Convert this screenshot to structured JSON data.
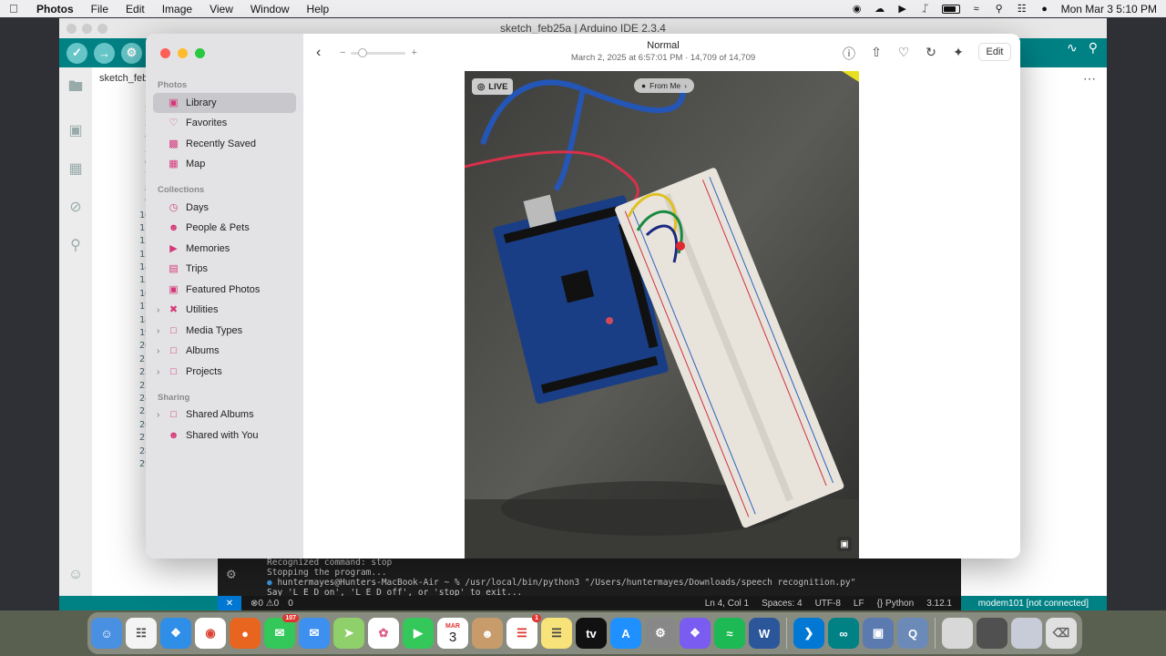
{
  "menubar": {
    "app": "Photos",
    "items": [
      "File",
      "Edit",
      "Image",
      "View",
      "Window",
      "Help"
    ],
    "clock": "Mon Mar 3  5:10 PM"
  },
  "arduino": {
    "title": "sketch_feb25a | Arduino IDE 2.3.4",
    "tab": "sketch_feb",
    "line_numbers": [
      "1",
      "2",
      "3",
      "4",
      "5",
      "6",
      "7",
      "8",
      "9",
      "10",
      "11",
      "12",
      "13",
      "14",
      "15",
      "16",
      "17",
      "18",
      "19",
      "20",
      "21",
      "22",
      "23",
      "24",
      "25",
      "26",
      "27",
      "28",
      "29"
    ],
    "code_fragments": [
      "c",
      "c",
      "c",
      "",
      "v",
      "",
      "",
      "",
      "",
      "}",
      "",
      "v",
      "",
      "",
      "",
      "",
      "",
      "",
      "",
      "",
      "",
      "",
      "",
      "",
      "",
      "",
      "",
      "",
      "}"
    ],
    "port_status": "modem101 [not connected]"
  },
  "terminal": {
    "lines": [
      "Recognized command: stop",
      "Stopping the program...",
      "huntermayes@Hunters-MacBook-Air ~ % /usr/local/bin/python3 \"/Users/huntermayes/Downloads/speech recognition.py\"",
      "Say 'L E D on', 'L E D off', or 'stop' to exit..."
    ]
  },
  "vscode_status": {
    "problems": "⊗0 ⚠0",
    "ports": "0",
    "position": "Ln 4, Col 1",
    "spaces": "Spaces: 4",
    "encoding": "UTF-8",
    "eol": "LF",
    "language": "{} Python",
    "version": "3.12.1"
  },
  "photos": {
    "sections": {
      "photos": "Photos",
      "collections": "Collections",
      "sharing": "Sharing"
    },
    "photos_items": [
      {
        "label": "Library",
        "icon": "library-icon"
      },
      {
        "label": "Favorites",
        "icon": "heart-icon"
      },
      {
        "label": "Recently Saved",
        "icon": "recent-icon"
      },
      {
        "label": "Map",
        "icon": "map-icon"
      }
    ],
    "collection_items": [
      {
        "label": "Days",
        "icon": "clock-icon"
      },
      {
        "label": "People & Pets",
        "icon": "person-icon"
      },
      {
        "label": "Memories",
        "icon": "memories-icon"
      },
      {
        "label": "Trips",
        "icon": "suitcase-icon"
      },
      {
        "label": "Featured Photos",
        "icon": "photo-icon"
      },
      {
        "label": "Utilities",
        "icon": "tools-icon"
      },
      {
        "label": "Media Types",
        "icon": "folder-icon"
      },
      {
        "label": "Albums",
        "icon": "folder-icon"
      },
      {
        "label": "Projects",
        "icon": "folder-icon"
      }
    ],
    "sharing_items": [
      {
        "label": "Shared Albums",
        "icon": "shared-album-icon"
      },
      {
        "label": "Shared with You",
        "icon": "shared-people-icon"
      }
    ],
    "viewer": {
      "title": "Normal",
      "subtitle": "March 2, 2025 at 6:57:01 PM  ·  14,709 of 14,709",
      "edit": "Edit",
      "live": "LIVE",
      "from_me": "From Me"
    }
  },
  "dock": {
    "calendar_month": "MAR",
    "calendar_day": "3",
    "messages_badge": "107",
    "reminders_badge": "1"
  },
  "colors": {
    "arduino_teal": "#008184",
    "photos_accent": "#d4387a",
    "terminal_bg": "#1e1e1e"
  }
}
